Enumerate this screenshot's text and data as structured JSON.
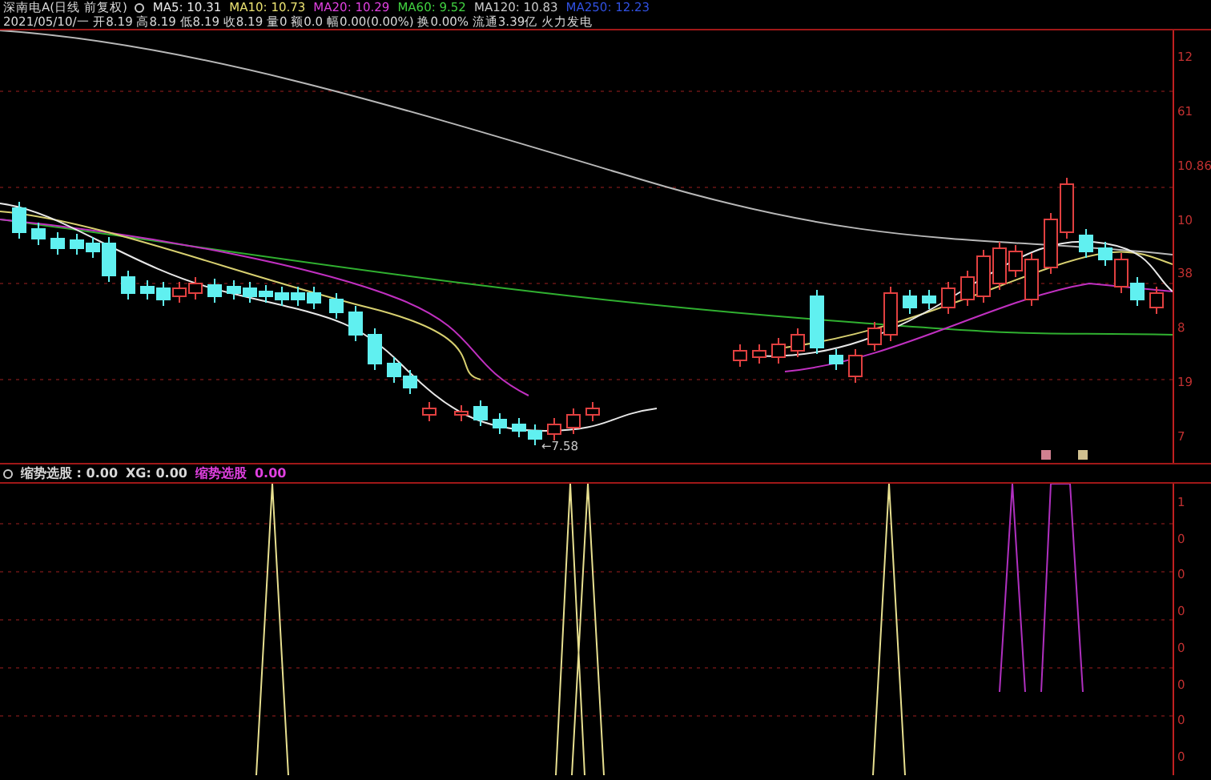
{
  "header": {
    "stock": "深南电A(日线 前复权)",
    "moving_averages": [
      {
        "label": "MA5: 10.31",
        "color": "#e8e8e8"
      },
      {
        "label": "MA10: 10.73",
        "color": "#e8e070"
      },
      {
        "label": "MA20: 10.29",
        "color": "#e040e0"
      },
      {
        "label": "MA60: 9.52",
        "color": "#40d040"
      },
      {
        "label": "MA120: 10.83",
        "color": "#c8c8c8"
      },
      {
        "label": "MA250: 12.23",
        "color": "#3050e0"
      }
    ],
    "quote_line": "2021/05/10/一 开8.19 高8.19 低8.19 收8.19 量0 额0.0 幅0.00(0.00%) 换0.00% 流通3.39亿 火力发电"
  },
  "price_axis": [
    "12",
    "61",
    "10.86",
    "10",
    "38",
    "8",
    "19",
    "7"
  ],
  "low_marker": "←7.58",
  "indicator": {
    "items": [
      {
        "text": "缩势选股 : 0.00",
        "kind": "plain"
      },
      {
        "text": "XG: 0.00",
        "kind": "plain"
      },
      {
        "text": "缩势选股",
        "kind": "highlight"
      },
      {
        "text": "0.00",
        "kind": "highlight"
      }
    ],
    "axis": [
      "1",
      "0",
      "0",
      "0",
      "0",
      "0",
      "0",
      "0"
    ]
  }
}
